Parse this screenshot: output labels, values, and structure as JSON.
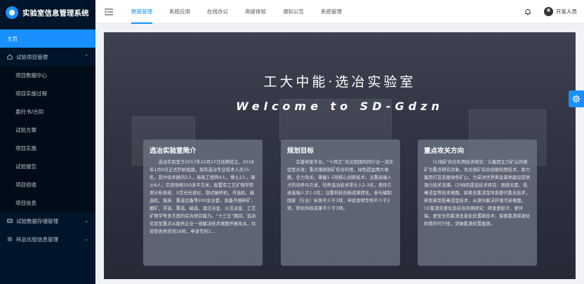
{
  "app": {
    "title": "实验室信息管理系统",
    "brand_color": "#1890ff"
  },
  "sidebar": {
    "home": "主页",
    "groups": [
      {
        "label": "试验项目管理",
        "expanded": true,
        "icon": "home-icon",
        "items": [
          "项目数据中心",
          "项目实施过程",
          "委托书/合同",
          "试验方案",
          "项目实施",
          "试验报告",
          "项目验收",
          "项目信息"
        ]
      },
      {
        "label": "试验数据存储管理",
        "expanded": false,
        "icon": "database-icon"
      },
      {
        "label": "样品化验信息管理",
        "expanded": false,
        "icon": "list-icon"
      }
    ]
  },
  "header": {
    "tabs": [
      "数据管理",
      "系统应用",
      "在线办公",
      "高级体验",
      "通知公告",
      "系统管理"
    ],
    "active_tab": "数据管理",
    "user": "开发人员"
  },
  "main": {
    "title_cn": "工大中能·选冶实验室",
    "title_en": "Welcome to SD-Gdzn",
    "cards": [
      {
        "title": "选冶实验室简介",
        "body": "选冶实验室于2017年10月27日挂牌成立，2018年1月9日正式开始组建。现有选冶专业技术人员15名，其中技术顾问2人，高级工程师4人，博士2人，硕士6人；实验场地550多平方米，配置有工艺矿物学检测分析系统、X荧光光谱仪、颚式破碎机、浮选机、磁选机、摇床、重选设备等200余台套，具备开展碎矿、磨矿、浮选、重选、磁选、湿法冶金、火法冶金、工艺矿物学等多方面的综合研究能力。“十三五”期间，选冶实验室重点从服务企业一线解决技术难题开展攻关，共荣获各类奖项18项，申请专利1..."
      },
      {
        "title": "规划目标",
        "body": "完善研发平台，“十四五”末达到国内同行业一流实验室水准；重点围绕铜矿综合利用、绿色提金两大难题，全力攻关，掌握1-3项核心创新技术；注重高端人才的培养与引进，培养选冶技术带头人2-3名，柔性引进高端人才1-2名；注重科技创新成果转化，参与编制国家（行业）标准不少于3项，申获发明专利不少于2项，转化科技成果不少于3项。"
      },
      {
        "title": "重点攻关方向",
        "body": "(1)铜矿综合利用技术研究：以集团主力矿山的铜矿为重点研究对象，攻关铜矿综合回收利用技术，助力集团打造无尾绿色矿山，为采洲世界黄金基地建设提供强力技术支撑。(2)绿色提金技术研究：围绕无氰、低毒浸金等技术难题，探索无氰浸金体系替代氰化技术，研发新型低毒浸金技术，从源头解决环境污染难题。(3)氰渣无害化及综合利用研究：研发更经济、更环保、更安全的氰渣无害化处置新技术；探索氰渣资源化利用的可行性，突破氰渣处置瓶颈。"
      }
    ]
  }
}
